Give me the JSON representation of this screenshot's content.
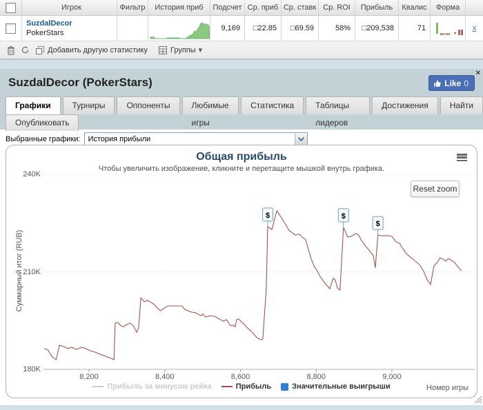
{
  "table": {
    "headers": {
      "player": "Игрок",
      "filter": "Фильтр",
      "history": "История приб",
      "count": "Подсчет",
      "avg_profit": "Ср. приб",
      "avg_stake": "Ср. ставк",
      "avg_roi": "Ср. ROI",
      "profit": "Прибыль",
      "qualis": "Квалис",
      "form": "Форма"
    },
    "row": {
      "player_name": "SuzdalDecor",
      "site": "PokerStars",
      "count": "9,169",
      "avg_profit": "□22.85",
      "avg_stake": "□69.59",
      "avg_roi": "58%",
      "profit": "□209,538",
      "qualis": "71",
      "remove_label": "x"
    },
    "history_spark": {
      "fill": "#8cc87f",
      "stroke": "#6fb46f",
      "points": [
        [
          2,
          31
        ],
        [
          2,
          29
        ],
        [
          8,
          29
        ],
        [
          8,
          31
        ],
        [
          26,
          31
        ],
        [
          26,
          30
        ],
        [
          44,
          30
        ],
        [
          44,
          31
        ],
        [
          53,
          31
        ],
        [
          57,
          28
        ],
        [
          61,
          26
        ],
        [
          64,
          24
        ],
        [
          66,
          20
        ],
        [
          68,
          22
        ],
        [
          71,
          16
        ],
        [
          73,
          14
        ],
        [
          75,
          9
        ],
        [
          77,
          8
        ],
        [
          79,
          11
        ],
        [
          81,
          9
        ],
        [
          83,
          12
        ],
        [
          85,
          10
        ],
        [
          87,
          13
        ],
        [
          88,
          31
        ]
      ]
    },
    "form_bars": [
      [
        8,
        6,
        3,
        16,
        "#7cbf59"
      ],
      [
        14,
        21,
        2,
        3,
        "#b06a62"
      ],
      [
        17,
        21,
        2,
        3,
        "#b06a62"
      ],
      [
        20,
        21,
        2,
        3,
        "#8fbf6a"
      ],
      [
        23,
        21,
        2,
        3,
        "#b06a62"
      ],
      [
        26,
        21,
        2,
        3,
        "#b06a62"
      ],
      [
        34,
        20,
        3,
        2,
        "#b06a62"
      ],
      [
        40,
        16,
        3,
        8,
        "#b06a62"
      ],
      [
        44,
        16,
        3,
        8,
        "#b06a62"
      ]
    ],
    "toolbar": {
      "add_label": "Добавить другую статистику",
      "groups_label": "Группы",
      "caret": "▾"
    }
  },
  "panel": {
    "title": "SuzdalDecor (PokerStars)",
    "like_label": "Like",
    "like_count": "0",
    "close_label": "✕",
    "tabs": [
      "Графики",
      "Турниры",
      "Оппоненты",
      "Любимые игры",
      "Статистика",
      "Таблицы лидеров",
      "Достижения",
      "Найти"
    ],
    "tab_publish": "Опубликовать",
    "selector_label": "Выбранные графики:",
    "selector_value": "История прибыли"
  },
  "chart_data": {
    "type": "line",
    "title": "Общая прибыль",
    "subtitle": "Чтобы увеличить изображение, кликните и перетащите мышкой внутрь графика.",
    "ylabel": "Суммарный итог (RUB)",
    "xlabel": "Номер игры",
    "reset_zoom_label": "Reset zoom",
    "xlim": [
      8080,
      9220
    ],
    "ylim": [
      180000,
      240000
    ],
    "grid": true,
    "legend_position": "bottom-center",
    "yticks": [
      {
        "label": "180K",
        "value": 180000
      },
      {
        "label": "210K",
        "value": 210000
      },
      {
        "label": "240K",
        "value": 240000
      }
    ],
    "xticks": [
      {
        "label": "8,200",
        "value": 8200
      },
      {
        "label": "8,400",
        "value": 8400
      },
      {
        "label": "8,600",
        "value": 8600
      },
      {
        "label": "8,800",
        "value": 8800
      },
      {
        "label": "9,000",
        "value": 9000
      }
    ],
    "legend": [
      {
        "label": "Прибыль за минусом рейка",
        "color": "#cccccc",
        "swatch": "line",
        "disabled": true
      },
      {
        "label": "Прибыль",
        "color": "#AA4643",
        "swatch": "line",
        "disabled": false
      },
      {
        "label": "Значительные выигрыши",
        "color": "#2f7ed8",
        "swatch": "square",
        "disabled": false
      }
    ],
    "series": [
      {
        "name": "Прибыль за минусом рейка",
        "visible": false,
        "color": "#cccccc",
        "points": []
      },
      {
        "name": "Прибыль",
        "visible": true,
        "color": "#a65350",
        "points": [
          [
            8082,
            186400
          ],
          [
            8091,
            186000
          ],
          [
            8103,
            183800
          ],
          [
            8113,
            183000
          ],
          [
            8122,
            187400
          ],
          [
            8134,
            187000
          ],
          [
            8144,
            186400
          ],
          [
            8154,
            186800
          ],
          [
            8167,
            186100
          ],
          [
            8180,
            186800
          ],
          [
            8191,
            186400
          ],
          [
            8204,
            185700
          ],
          [
            8216,
            185300
          ],
          [
            8227,
            184700
          ],
          [
            8240,
            184200
          ],
          [
            8253,
            183600
          ],
          [
            8266,
            183000
          ],
          [
            8269,
            194200
          ],
          [
            8277,
            194400
          ],
          [
            8284,
            193400
          ],
          [
            8291,
            193100
          ],
          [
            8300,
            193800
          ],
          [
            8309,
            194200
          ],
          [
            8317,
            193400
          ],
          [
            8326,
            191400
          ],
          [
            8331,
            192900
          ],
          [
            8337,
            202000
          ],
          [
            8346,
            200800
          ],
          [
            8355,
            201200
          ],
          [
            8371,
            200100
          ],
          [
            8380,
            198900
          ],
          [
            8389,
            198000
          ],
          [
            8399,
            198900
          ],
          [
            8408,
            199500
          ],
          [
            8431,
            199500
          ],
          [
            8446,
            199500
          ],
          [
            8453,
            198400
          ],
          [
            8471,
            197600
          ],
          [
            8482,
            197400
          ],
          [
            8495,
            196500
          ],
          [
            8501,
            197000
          ],
          [
            8508,
            196100
          ],
          [
            8519,
            196500
          ],
          [
            8532,
            196300
          ],
          [
            8544,
            195500
          ],
          [
            8555,
            194800
          ],
          [
            8563,
            195300
          ],
          [
            8568,
            194400
          ],
          [
            8574,
            193400
          ],
          [
            8581,
            193600
          ],
          [
            8586,
            193100
          ],
          [
            8590,
            195300
          ],
          [
            8595,
            195500
          ],
          [
            8601,
            194800
          ],
          [
            8610,
            193800
          ],
          [
            8619,
            192700
          ],
          [
            8628,
            191700
          ],
          [
            8637,
            190600
          ],
          [
            8646,
            189500
          ],
          [
            8656,
            189100
          ],
          [
            8659,
            189500
          ],
          [
            8668,
            204400
          ],
          [
            8672,
            223900
          ],
          [
            8683,
            223000
          ],
          [
            8696,
            228800
          ],
          [
            8714,
            225600
          ],
          [
            8728,
            222800
          ],
          [
            8745,
            221300
          ],
          [
            8756,
            221600
          ],
          [
            8763,
            220700
          ],
          [
            8772,
            219900
          ],
          [
            8787,
            213900
          ],
          [
            8796,
            211400
          ],
          [
            8801,
            210700
          ],
          [
            8810,
            208600
          ],
          [
            8823,
            206500
          ],
          [
            8836,
            204800
          ],
          [
            8845,
            208000
          ],
          [
            8850,
            207600
          ],
          [
            8856,
            205000
          ],
          [
            8863,
            204400
          ],
          [
            8872,
            223700
          ],
          [
            8883,
            220700
          ],
          [
            8892,
            220900
          ],
          [
            8905,
            221800
          ],
          [
            8912,
            221300
          ],
          [
            8920,
            219600
          ],
          [
            8932,
            217700
          ],
          [
            8941,
            216500
          ],
          [
            8951,
            215000
          ],
          [
            8956,
            211200
          ],
          [
            8963,
            221300
          ],
          [
            8972,
            221100
          ],
          [
            8992,
            221100
          ],
          [
            9000,
            220900
          ],
          [
            9011,
            219200
          ],
          [
            9020,
            218800
          ],
          [
            9029,
            217100
          ],
          [
            9038,
            215600
          ],
          [
            9051,
            214300
          ],
          [
            9060,
            213500
          ],
          [
            9073,
            212200
          ],
          [
            9084,
            210100
          ],
          [
            9093,
            207600
          ],
          [
            9102,
            206100
          ],
          [
            9111,
            211800
          ],
          [
            9120,
            212900
          ],
          [
            9127,
            214300
          ],
          [
            9135,
            213900
          ],
          [
            9142,
            213300
          ],
          [
            9149,
            214100
          ],
          [
            9158,
            213500
          ],
          [
            9165,
            212900
          ],
          [
            9174,
            211600
          ],
          [
            9184,
            210300
          ]
        ]
      },
      {
        "name": "Значительные выигрыши",
        "visible": true,
        "type": "flags",
        "color": "#2f7ed8",
        "flag_border": "#69a0c8",
        "flag_fill": "#f6fafd",
        "flags": [
          {
            "x": 8672,
            "y": 223900,
            "label": "$"
          },
          {
            "x": 8872,
            "y": 223700,
            "label": "$"
          },
          {
            "x": 8963,
            "y": 221300,
            "label": "$"
          }
        ]
      }
    ]
  }
}
